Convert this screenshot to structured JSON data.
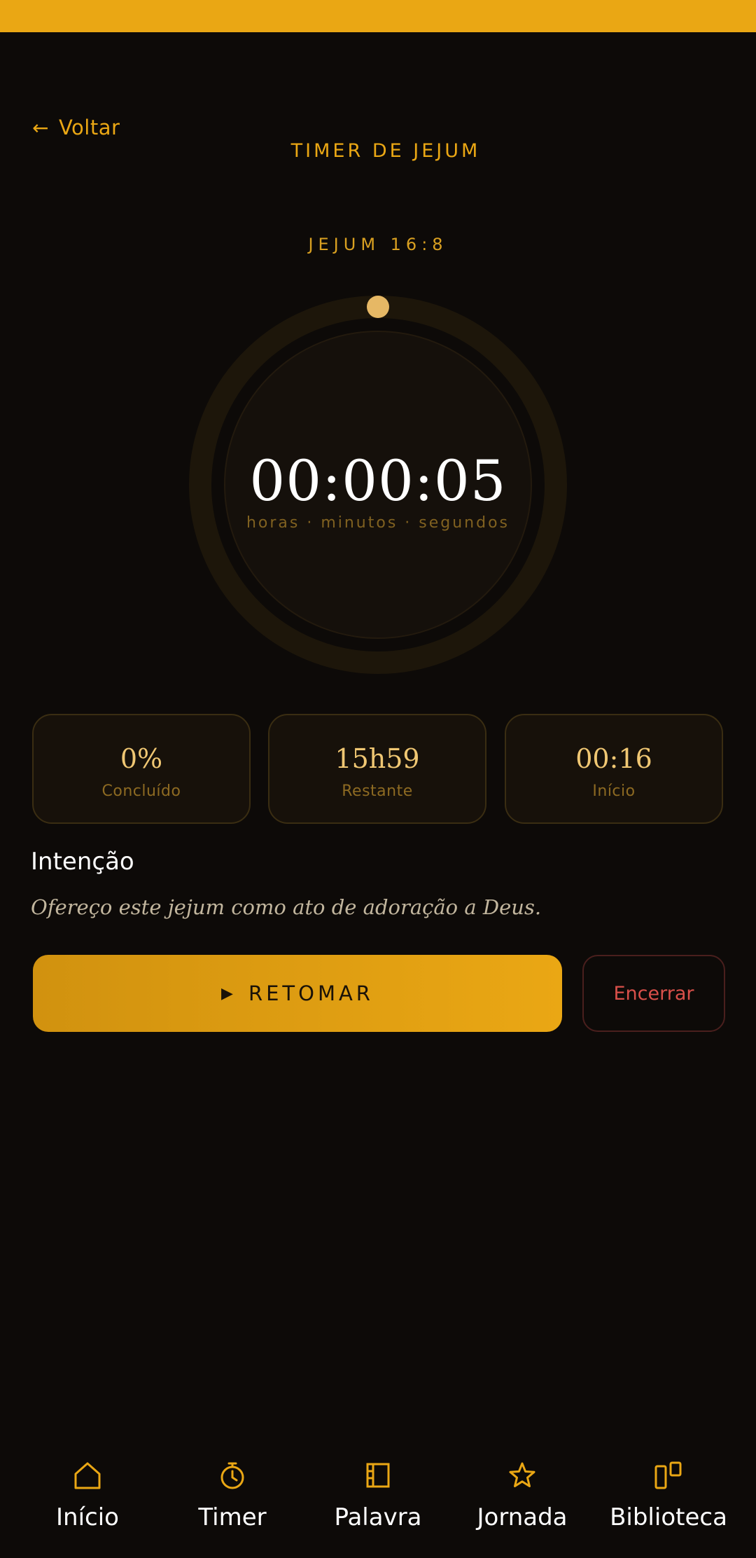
{
  "header": {
    "back_label": "Voltar",
    "title": "TIMER DE JEJUM"
  },
  "timer": {
    "protocol": "JEJUM 16:8",
    "elapsed": "00:00:05",
    "units": "horas · minutos · segundos",
    "progress": 0
  },
  "stats": [
    {
      "value": "0%",
      "label": "Concluído"
    },
    {
      "value": "15h59",
      "label": "Restante"
    },
    {
      "value": "00:16",
      "label": "Início"
    }
  ],
  "intention": {
    "title": "Intenção",
    "text": "Ofereço este jejum como ato de adoração a Deus."
  },
  "actions": {
    "play_icon": "▶",
    "resume_label": "RETOMAR",
    "end_label": "Encerrar"
  },
  "nav": [
    {
      "label": "Início",
      "icon": "home-icon"
    },
    {
      "label": "Timer",
      "icon": "timer-icon"
    },
    {
      "label": "Palavra",
      "icon": "book-icon"
    },
    {
      "label": "Jornada",
      "icon": "star-icon"
    },
    {
      "label": "Biblioteca",
      "icon": "library-icon"
    }
  ],
  "colors": {
    "accent": "#eaa714",
    "background": "#0d0a08",
    "danger": "#d9504a",
    "stat_value": "#f0c773"
  }
}
